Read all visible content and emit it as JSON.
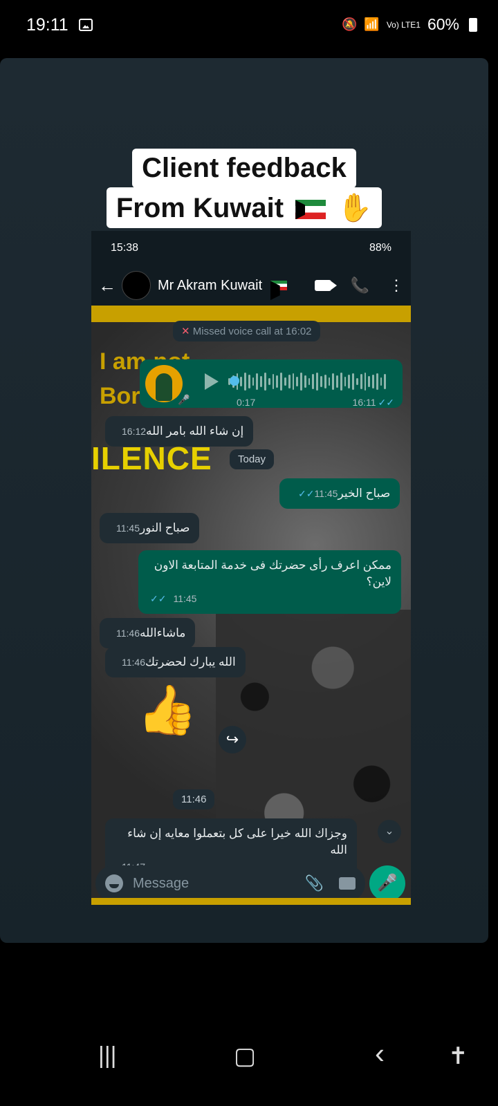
{
  "status_bar": {
    "time": "19:11",
    "battery": "60%",
    "network": "Vo) LTE1"
  },
  "caption": {
    "line1": "Client feedback",
    "line2": "From Kuwait",
    "emoji": "✋"
  },
  "inner_status": {
    "time": "15:38",
    "battery": "88%"
  },
  "chat_header": {
    "contact": "Mr Akram Kuwait"
  },
  "poster": {
    "top_text": "I am not\nBorn T",
    "big_text": "ILENCE"
  },
  "messages": {
    "missed_call": "Missed voice call at 16:02",
    "voice": {
      "duration": "0:17",
      "time": "16:11"
    },
    "m1": {
      "text": "إن شاء الله بامر الله",
      "time": "16:12"
    },
    "today": "Today",
    "m2": {
      "text": "صباح الخير",
      "time": "11:45"
    },
    "m3": {
      "text": "صباح النور",
      "time": "11:45"
    },
    "m4": {
      "text": "ممكن اعرف رأى حضرتك فى خدمة المتابعة الاون لاين؟",
      "time": "11:45"
    },
    "m5": {
      "text": "ماشاءالله",
      "time": "11:46"
    },
    "m6": {
      "text": "الله يبارك لحضرتك",
      "time": "11:46"
    },
    "sticker_time": "11:46",
    "m7": {
      "text": "وجزاك الله خيرا على كل بتعملوا معايه إن شاء الله",
      "time": "11:47"
    }
  },
  "input": {
    "placeholder": "Message"
  },
  "icons": [
    "gallery-icon",
    "back-arrow-icon",
    "video-call-icon",
    "phone-icon",
    "more-icon",
    "play-icon",
    "mic-icon",
    "forward-icon",
    "emoji-icon",
    "attach-icon",
    "camera-icon",
    "chevron-down-icon"
  ]
}
